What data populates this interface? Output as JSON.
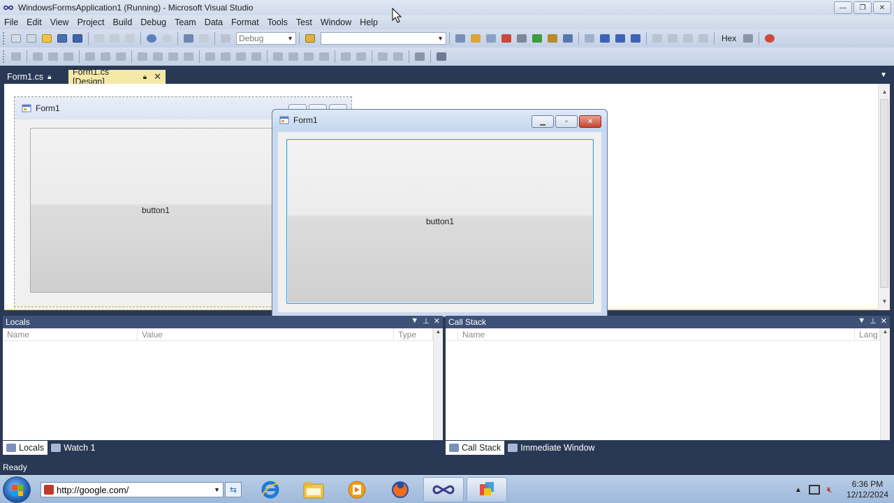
{
  "window": {
    "title": "WindowsFormsApplication1 (Running) - Microsoft Visual Studio",
    "minimize": "—",
    "restore": "❐",
    "close": "✕"
  },
  "menu": [
    "File",
    "Edit",
    "View",
    "Project",
    "Build",
    "Debug",
    "Team",
    "Data",
    "Format",
    "Tools",
    "Test",
    "Window",
    "Help"
  ],
  "toolbar": {
    "config_value": "Debug",
    "platform_value": "",
    "hex_label": "Hex"
  },
  "doc_tabs": [
    {
      "label": "Form1.cs",
      "active": false
    },
    {
      "label": "Form1.cs [Design]",
      "active": true
    }
  ],
  "designer": {
    "form_title": "Form1",
    "button_label": "button1"
  },
  "running_form": {
    "title": "Form1",
    "button_label": "button1"
  },
  "locals_pane": {
    "title": "Locals",
    "columns": [
      "Name",
      "Value",
      "Type"
    ],
    "tabs": [
      "Locals",
      "Watch 1"
    ]
  },
  "callstack_pane": {
    "title": "Call Stack",
    "columns": [
      "Name",
      "Lang"
    ],
    "tabs": [
      "Call Stack",
      "Immediate Window"
    ]
  },
  "status": {
    "text": "Ready"
  },
  "taskbar": {
    "address_value": "http://google.com/",
    "time": "6:36 PM",
    "date": "12/12/2024"
  },
  "icons": {
    "vs": "vs-infinity-icon",
    "ie": "internet-explorer-icon",
    "explorer": "file-explorer-icon",
    "media": "media-player-icon",
    "firefox": "firefox-icon",
    "office": "office-icon"
  },
  "colors": {
    "chrome_dark": "#293955",
    "active_tab": "#f5e9a8",
    "pane_header": "#3e5278",
    "focus_border": "#3c9ad8"
  }
}
